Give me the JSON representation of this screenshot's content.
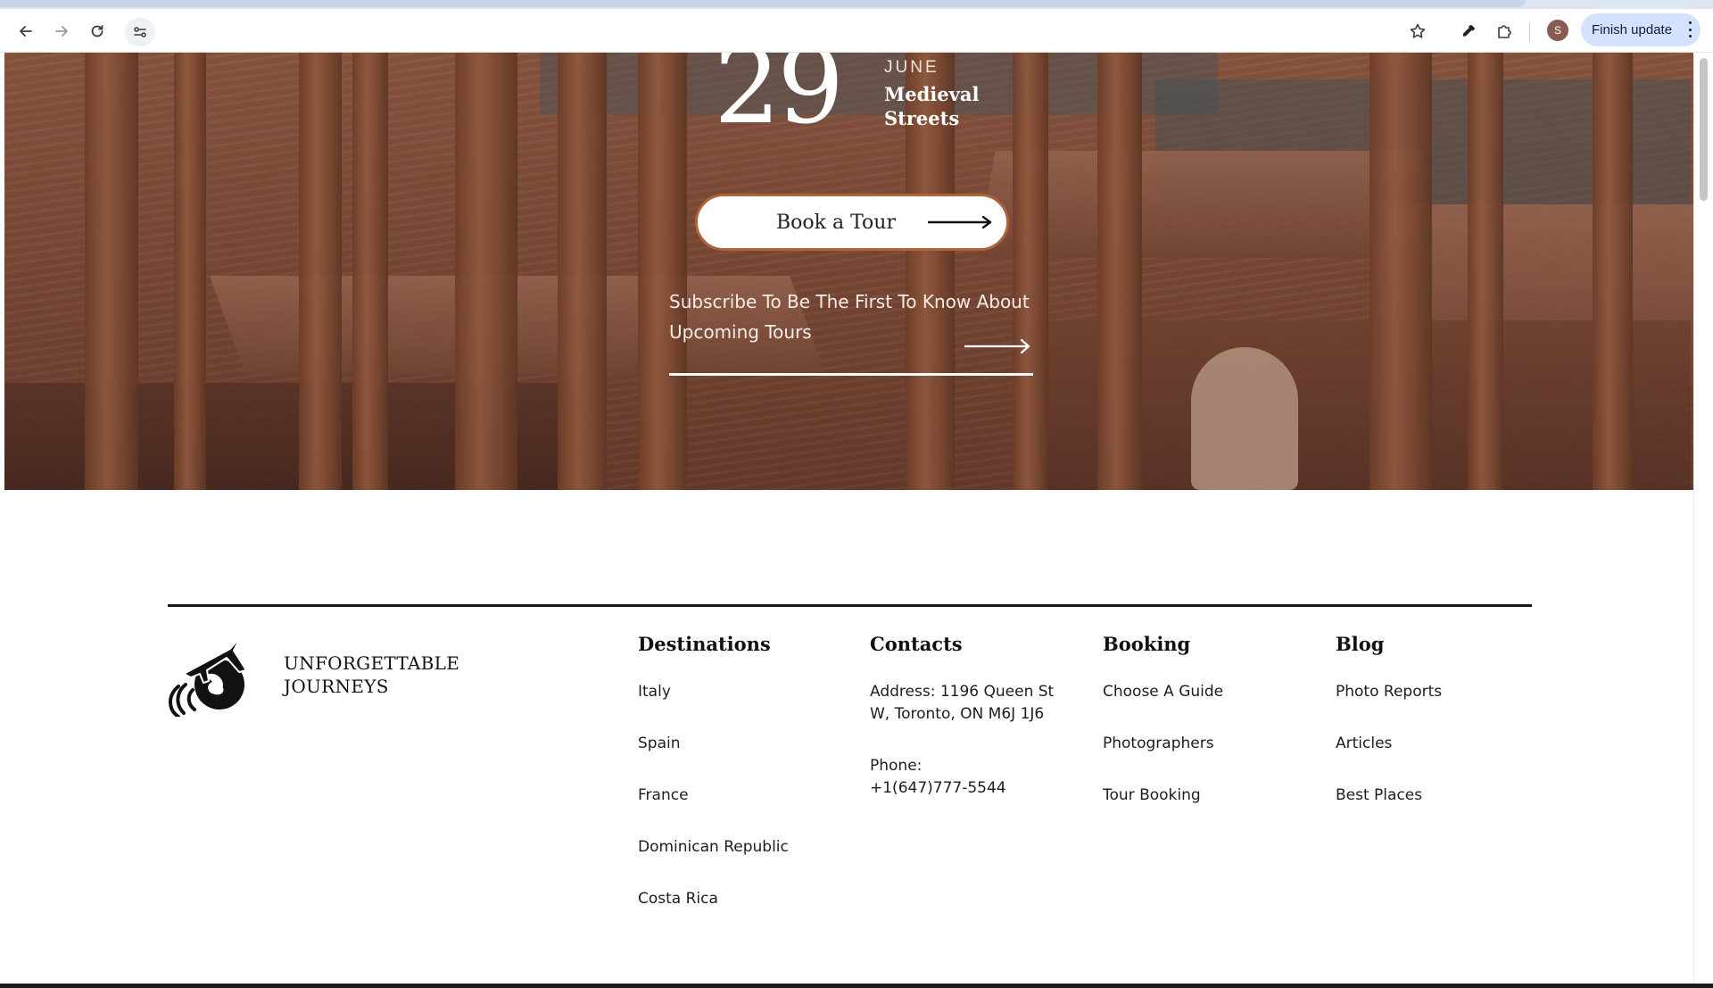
{
  "browser": {
    "back_icon": "arrow-left-icon",
    "forward_icon": "arrow-right-icon",
    "reload_icon": "reload-icon",
    "site_info_icon": "tune-icon",
    "bookmark_icon": "star-icon",
    "eyedropper_icon": "eyedropper-icon",
    "extensions_icon": "puzzle-icon",
    "avatar_initial": "S",
    "finish_update_label": "Finish update",
    "menu_icon": "kebab-menu-icon"
  },
  "hero": {
    "date_day": "29",
    "date_month": "JUNE",
    "tour_title": "Medieval Streets",
    "book_button_label": "Book a Tour",
    "subscribe_text": "Subscribe To Be The First To Know About Upcoming Tours",
    "accent_color": "#b0623c"
  },
  "footer": {
    "brand": "UNFORGETTABLE JOURNEYS",
    "columns": [
      {
        "title": "Destinations",
        "items": [
          "Italy",
          "Spain",
          "France",
          "Dominican Republic",
          "Costa Rica"
        ]
      },
      {
        "title": "Contacts",
        "address": "Address: 1196 Queen St W, Toronto, ON M6J 1J6",
        "phone": "Phone: +1(647)777-5544"
      },
      {
        "title": "Booking",
        "items": [
          "Choose A Guide",
          "Photographers",
          "Tour Booking"
        ]
      },
      {
        "title": "Blog",
        "items": [
          "Photo Reports",
          "Articles",
          "Best Places"
        ]
      }
    ]
  }
}
